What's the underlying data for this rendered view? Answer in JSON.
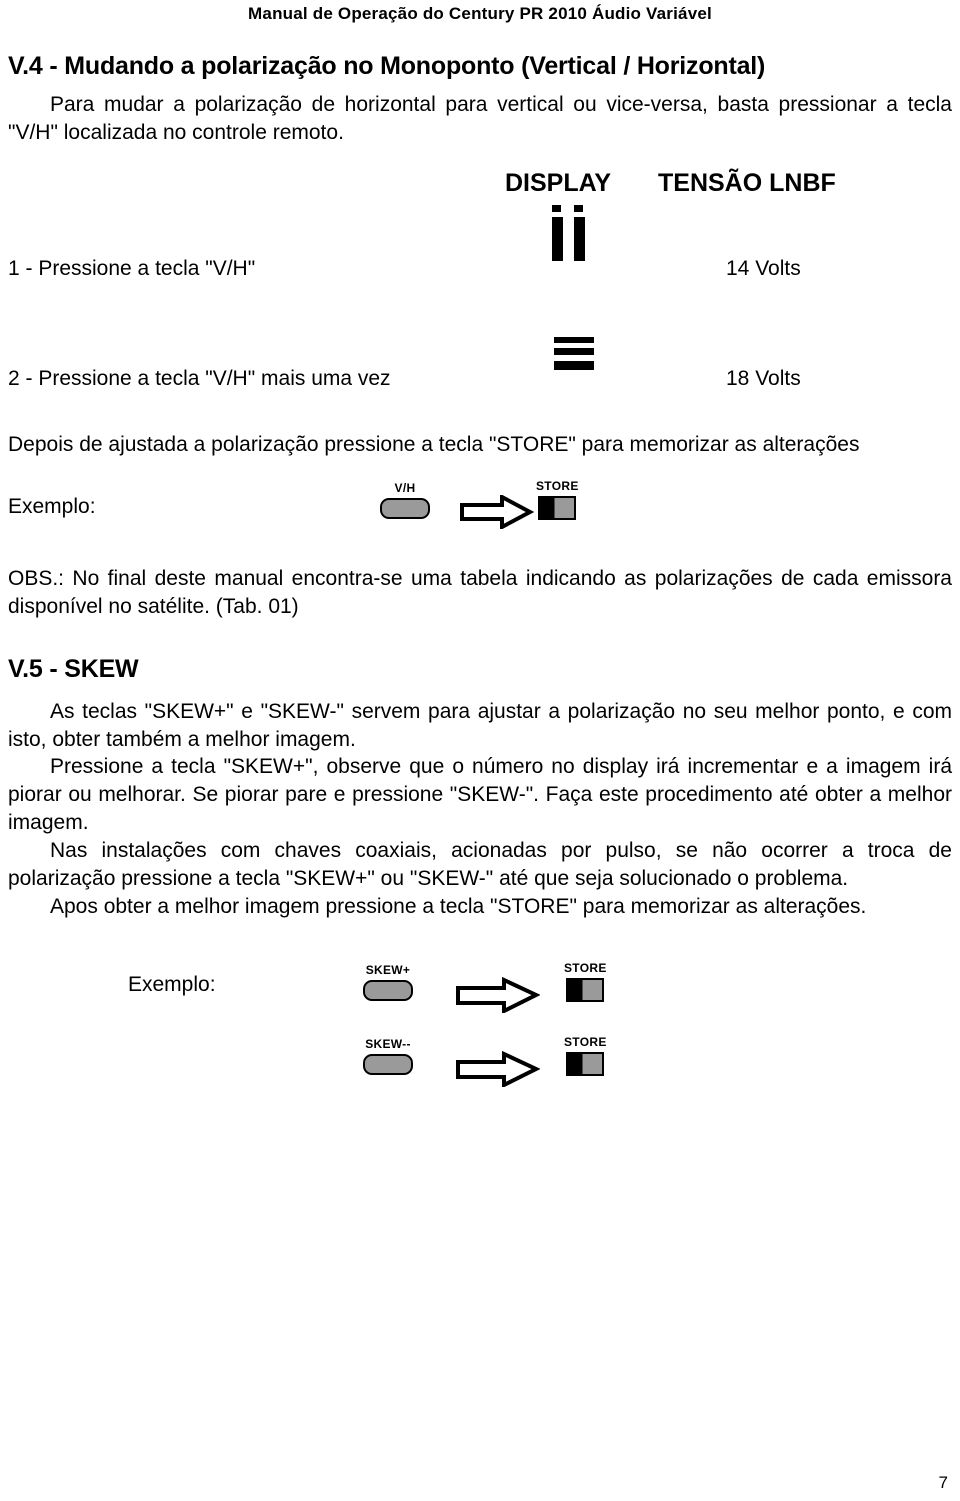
{
  "header": {
    "title": "Manual de Operação do Century PR 2010 Áudio Variável"
  },
  "sections": {
    "v4": {
      "heading": "V.4 - Mudando a polarização no Monoponto (Vertical / Horizontal)",
      "intro": "Para mudar a polarização de horizontal para vertical ou vice-versa, basta pressionar a tecla \"V/H\" localizada no controle remoto.",
      "table": {
        "col1_header": "DISPLAY",
        "col2_header": "TENSÃO LNBF",
        "rows": [
          {
            "label": "1 - Pressione a tecla \"V/H\"",
            "display_icon": "vertical-bars-icon",
            "voltage": "14 Volts"
          },
          {
            "label": "2 - Pressione a tecla \"V/H\" mais uma vez",
            "display_icon": "horizontal-bars-icon",
            "voltage": "18 Volts"
          }
        ]
      },
      "store_note": "Depois de ajustada a polarização pressione a tecla \"STORE\" para memorizar as alterações",
      "example_label": "Exemplo:",
      "example_keys": {
        "key1": "V/H",
        "key2": "STORE"
      },
      "obs": "OBS.: No final deste manual encontra-se uma tabela indicando as polarizações de cada emissora disponível no satélite. (Tab. 01)"
    },
    "v5": {
      "heading": "V.5 - SKEW",
      "p1": "As teclas \"SKEW+\" e \"SKEW-\" servem para ajustar a polarização no seu melhor ponto, e com isto, obter também a melhor imagem.",
      "p2": "Pressione a tecla \"SKEW+\", observe que o número no display irá incrementar e a imagem irá piorar ou melhorar. Se piorar pare e pressione \"SKEW-\". Faça este procedimento até obter a melhor imagem.",
      "p3": "Nas instalações com chaves coaxiais, acionadas por pulso, se não ocorrer a troca de polarização pressione a tecla \"SKEW+\" ou \"SKEW-\" até que seja solucionado o problema.",
      "p4": "Apos obter a melhor imagem pressione a tecla \"STORE\" para memorizar as alterações.",
      "example_label": "Exemplo:",
      "example_keys": {
        "row1_key": "SKEW+",
        "row1_store": "STORE",
        "row2_key": "SKEW--",
        "row2_store": "STORE"
      }
    }
  },
  "footer": {
    "page_number": "7"
  }
}
